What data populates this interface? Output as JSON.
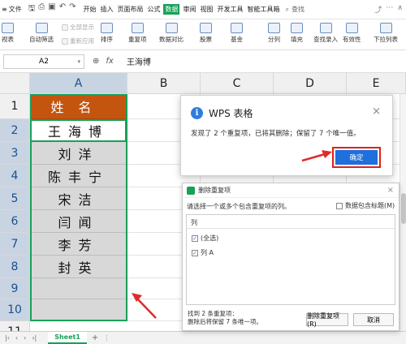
{
  "menubar": {
    "file": "文件",
    "tabs": [
      "开始",
      "插入",
      "页面布局",
      "公式",
      "数据",
      "审阅",
      "视图",
      "开发工具",
      "智能工具箱"
    ],
    "active_tab": "数据",
    "search": "查找"
  },
  "ribbon": {
    "pivot": "视表",
    "autofilter": "自动筛选",
    "show_all": "全部显示",
    "reapply": "重新应用",
    "sort": "排序",
    "dup": "重复项",
    "compare": "数据对比",
    "stock": "股票",
    "fund": "基金",
    "split": "分列",
    "fill": "填充",
    "entry": "查找录入",
    "validity": "有效性",
    "dropdown": "下拉列表"
  },
  "formula": {
    "cell_ref": "A2",
    "fx": "fx",
    "value": "王海博"
  },
  "grid": {
    "columns": [
      "A",
      "B",
      "C",
      "D",
      "E"
    ],
    "rows": [
      "1",
      "2",
      "3",
      "4",
      "5",
      "6",
      "7",
      "8",
      "9",
      "10",
      "11"
    ],
    "column_a": [
      "姓名",
      "王海博",
      "刘洋",
      "陈丰宁",
      "宋洁",
      "闫闻",
      "李芳",
      "封英",
      "",
      ""
    ]
  },
  "sheets": {
    "tab": "Sheet1"
  },
  "dialog_info": {
    "title": "WPS 表格",
    "message": "发现了 2 个重复项，已将其删除；保留了 7 个唯一值。",
    "ok": "确定"
  },
  "dialog_dup": {
    "title": "删除重复项",
    "instruction": "请选择一个或多个包含重复项的列。",
    "header_check": "数据包含标题(M)",
    "list_header": "列",
    "items": [
      "(全选)",
      "列 A"
    ],
    "footer1": "找到 2 条重复项：",
    "footer2": "删除后将保留 7 条唯一项。",
    "btn1": "删除重复项(R)",
    "btn2": "取消"
  },
  "colors": {
    "wps_green": "#18a058",
    "header_fill": "#c4550f",
    "ok_blue": "#1f6fdc",
    "highlight_red": "#e0201b",
    "arrow_red": "#e02a2a"
  }
}
